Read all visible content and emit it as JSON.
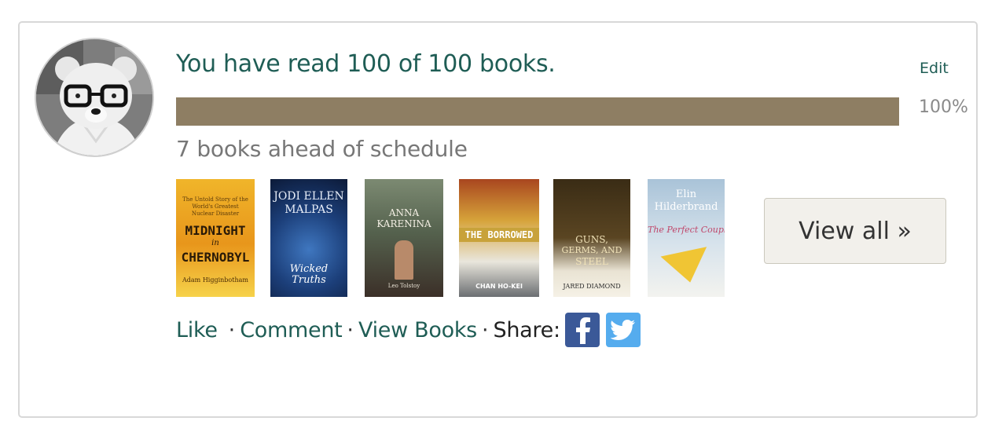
{
  "goal": {
    "headline": "You have read 100 of 100 books.",
    "edit_label": "Edit",
    "progress_fraction": 1.0,
    "percent_label": "100%",
    "schedule_text": "7 books ahead of schedule"
  },
  "books": [
    {
      "title_lines": [
        "MIDNIGHT",
        "in",
        "CHERNOBYL"
      ],
      "tagline": "The Untold Story of the World's Greatest Nuclear Disaster",
      "author": "Adam Higginbotham",
      "color": "#e8a21c"
    },
    {
      "title_lines": [
        "JODI ELLEN",
        "MALPAS"
      ],
      "subtitle": "Wicked Truths",
      "color": "#1a3a6b"
    },
    {
      "title_lines": [
        "ANNA",
        "KARENINA"
      ],
      "author": "Leo Tolstoy",
      "color": "#5b6a55"
    },
    {
      "title_lines": [
        "THE BORROWED"
      ],
      "author": "CHAN HO-KEI",
      "color": "#c9a43a"
    },
    {
      "title_lines": [
        "GUNS,",
        "GERMS, AND",
        "STEEL"
      ],
      "author": "JARED DIAMOND",
      "color": "#2b2213"
    },
    {
      "title_lines": [
        "Elin",
        "Hilderbrand"
      ],
      "subtitle": "The Perfect Couple",
      "color": "#bcd0df"
    }
  ],
  "view_all_label": "View all »",
  "actions": {
    "like": "Like",
    "comment": "Comment",
    "view_books": "View Books",
    "share_label": "Share:",
    "facebook_icon": "facebook-icon",
    "twitter_icon": "twitter-icon",
    "facebook_color": "#3b5998",
    "twitter_color": "#55acee"
  }
}
